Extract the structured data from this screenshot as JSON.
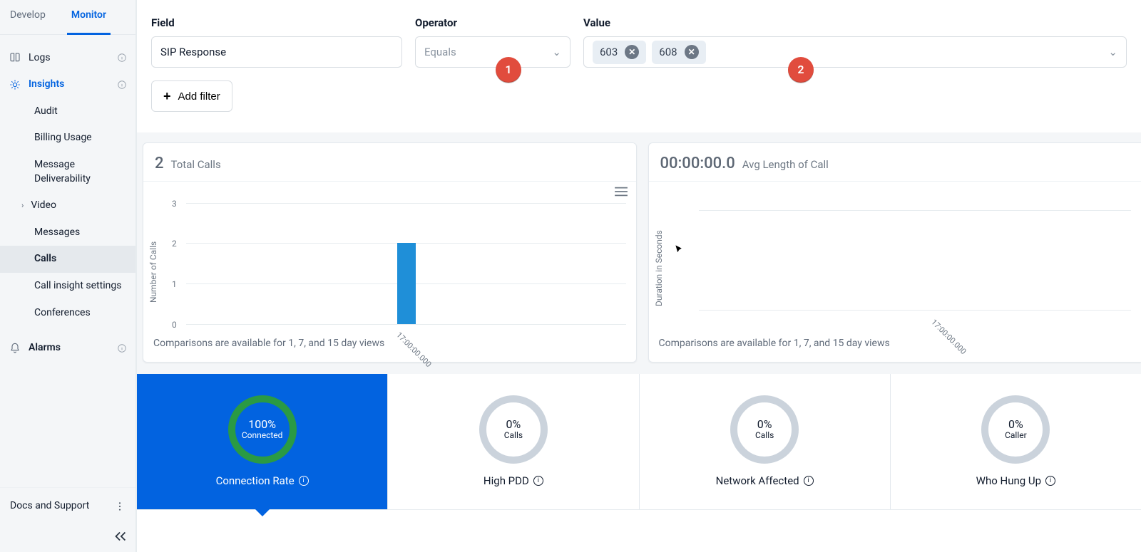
{
  "tabs": {
    "develop": "Develop",
    "monitor": "Monitor",
    "active": "monitor"
  },
  "sidebar": {
    "logs": "Logs",
    "insights": "Insights",
    "alarms": "Alarms",
    "items": [
      {
        "label": "Audit"
      },
      {
        "label": "Billing Usage"
      },
      {
        "label": "Message Deliverability"
      },
      {
        "label": "Video",
        "expandable": true
      },
      {
        "label": "Messages"
      },
      {
        "label": "Calls",
        "selected": true
      },
      {
        "label": "Call insight settings"
      },
      {
        "label": "Conferences"
      }
    ],
    "docs": "Docs and Support"
  },
  "filters": {
    "field_label": "Field",
    "field_value": "SIP Response",
    "operator_label": "Operator",
    "operator_value": "Equals",
    "value_label": "Value",
    "values": [
      "603",
      "608"
    ],
    "add_filter": "Add filter"
  },
  "badges": {
    "one": "1",
    "two": "2"
  },
  "card_left": {
    "count": "2",
    "title": "Total Calls",
    "ylabel": "Number of Calls",
    "note": "Comparisons are available for 1, 7, and 15 day views"
  },
  "card_right": {
    "count": "00:00:00.0",
    "title": "Avg Length of Call",
    "ylabel": "Duration in Seconds",
    "note": "Comparisons are available for 1, 7, and 15 day views"
  },
  "chart_data": [
    {
      "type": "bar",
      "title": "Total Calls",
      "ylabel": "Number of Calls",
      "categories": [
        "17:00:00.000"
      ],
      "values": [
        2
      ],
      "yticks": [
        0,
        1,
        2,
        3
      ],
      "ylim": [
        0,
        3
      ]
    },
    {
      "type": "line",
      "title": "Avg Length of Call",
      "ylabel": "Duration in Seconds",
      "categories": [
        "17:00:00.000"
      ],
      "values": [
        0
      ],
      "yticks": [],
      "ylim": [
        0,
        1
      ]
    }
  ],
  "tiles": [
    {
      "pct": "100%",
      "sub": "Connected",
      "title": "Connection Rate",
      "active": true
    },
    {
      "pct": "0%",
      "sub": "Calls",
      "title": "High PDD",
      "active": false
    },
    {
      "pct": "0%",
      "sub": "Calls",
      "title": "Network Affected",
      "active": false
    },
    {
      "pct": "0%",
      "sub": "Caller",
      "title": "Who Hung Up",
      "active": false
    }
  ]
}
